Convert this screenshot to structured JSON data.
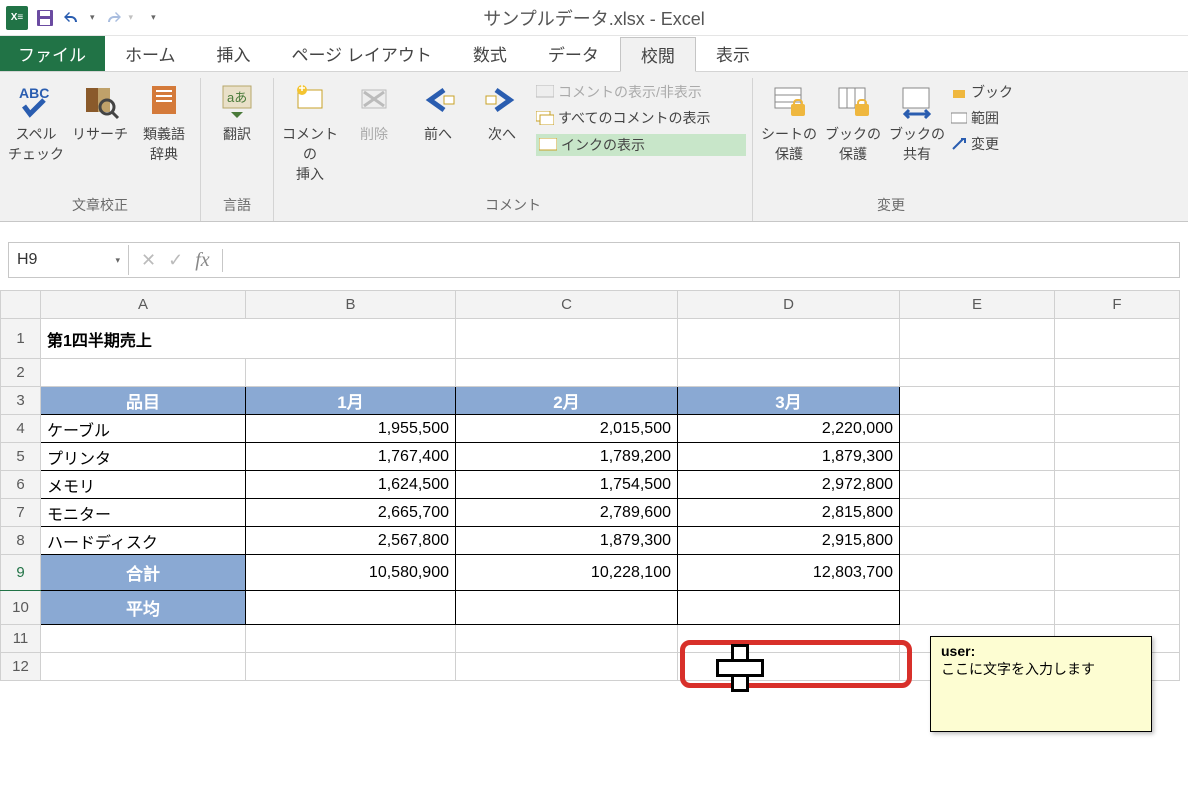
{
  "app_title": "サンプルデータ.xlsx - Excel",
  "tabs": {
    "file": "ファイル",
    "home": "ホーム",
    "insert": "挿入",
    "pagelayout": "ページ レイアウト",
    "formulas": "数式",
    "data": "データ",
    "review": "校閲",
    "view": "表示"
  },
  "ribbon": {
    "proofing": {
      "label": "文章校正",
      "spell": "スペル\nチェック",
      "research": "リサーチ",
      "thesaurus": "類義語\n辞典"
    },
    "language": {
      "label": "言語",
      "translate": "翻訳"
    },
    "comments": {
      "label": "コメント",
      "new": "コメントの\n挿入",
      "delete": "削除",
      "prev": "前へ",
      "next": "次へ",
      "toggle": "コメントの表示/非表示",
      "show_all": "すべてのコメントの表示",
      "show_ink": "インクの表示"
    },
    "changes": {
      "label": "変更",
      "protect_sheet": "シートの\n保護",
      "protect_book": "ブックの\n保護",
      "share_book": "ブックの\n共有",
      "extra_protect_share": "ブック",
      "extra_range": "範囲",
      "extra_track": "変更"
    }
  },
  "name_box": "H9",
  "formula": "",
  "columns": [
    "A",
    "B",
    "C",
    "D",
    "E",
    "F"
  ],
  "row_numbers": [
    1,
    2,
    3,
    4,
    5,
    6,
    7,
    8,
    9,
    10,
    11,
    12
  ],
  "sheet": {
    "title": "第1四半期売上",
    "header": {
      "item": "品目",
      "m1": "1月",
      "m2": "2月",
      "m3": "3月"
    },
    "rows": [
      {
        "item": "ケーブル",
        "m1": "1,955,500",
        "m2": "2,015,500",
        "m3": "2,220,000"
      },
      {
        "item": "プリンタ",
        "m1": "1,767,400",
        "m2": "1,789,200",
        "m3": "1,879,300"
      },
      {
        "item": "メモリ",
        "m1": "1,624,500",
        "m2": "1,754,500",
        "m3": "2,972,800"
      },
      {
        "item": "モニター",
        "m1": "2,665,700",
        "m2": "2,789,600",
        "m3": "2,815,800"
      },
      {
        "item": "ハードディスク",
        "m1": "2,567,800",
        "m2": "1,879,300",
        "m3": "2,915,800"
      }
    ],
    "total_label": "合計",
    "totals": {
      "m1": "10,580,900",
      "m2": "10,228,100",
      "m3": "12,803,700"
    },
    "avg_label": "平均"
  },
  "comment": {
    "author": "user:",
    "body": "ここに文字を入力します"
  },
  "chart_data": {
    "type": "table",
    "title": "第1四半期売上",
    "columns": [
      "品目",
      "1月",
      "2月",
      "3月"
    ],
    "rows": [
      [
        "ケーブル",
        1955500,
        2015500,
        2220000
      ],
      [
        "プリンタ",
        1767400,
        1789200,
        1879300
      ],
      [
        "メモリ",
        1624500,
        1754500,
        2972800
      ],
      [
        "モニター",
        2665700,
        2789600,
        2815800
      ],
      [
        "ハードディスク",
        2567800,
        1879300,
        2915800
      ]
    ],
    "totals": [
      10580900,
      10228100,
      12803700
    ]
  }
}
